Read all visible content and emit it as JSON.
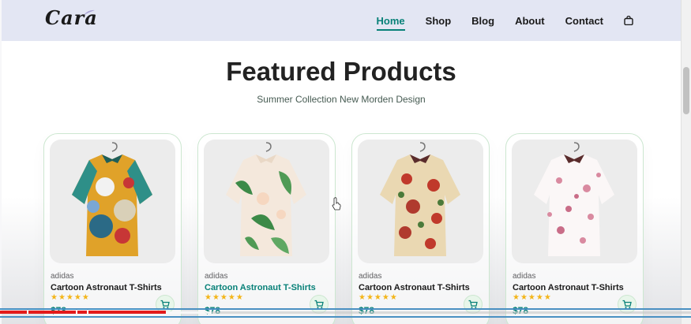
{
  "header": {
    "logo": "Cara",
    "nav": [
      "Home",
      "Shop",
      "Blog",
      "About",
      "Contact"
    ],
    "active_nav": "Home",
    "cart_icon": "shopping-bag-icon"
  },
  "section": {
    "title": "Featured Products",
    "subtitle": "Summer Collection New Morden Design"
  },
  "products": [
    {
      "brand": "adidas",
      "name": "Cartoon Astronaut T-Shirts",
      "rating": "★★★★★",
      "price": "$78",
      "shirt": "multicolor-print-shirt"
    },
    {
      "brand": "adidas",
      "name": "Cartoon Astronaut T-Shirts",
      "rating": "★★★★★",
      "price": "$78",
      "shirt": "tropical-leaf-shirt"
    },
    {
      "brand": "adidas",
      "name": "Cartoon Astronaut T-Shirts",
      "rating": "★★★★★",
      "price": "$78",
      "shirt": "floral-beige-shirt"
    },
    {
      "brand": "adidas",
      "name": "Cartoon Astronaut T-Shirts",
      "rating": "★★★★★",
      "price": "$78",
      "shirt": "white-pink-floral-shirt"
    }
  ],
  "colors": {
    "accent": "#088178",
    "header_bg": "#e3e6f3",
    "star": "#f3b519",
    "progress_played": "#e31b1b"
  },
  "video": {
    "progress_fraction": 0.24
  }
}
